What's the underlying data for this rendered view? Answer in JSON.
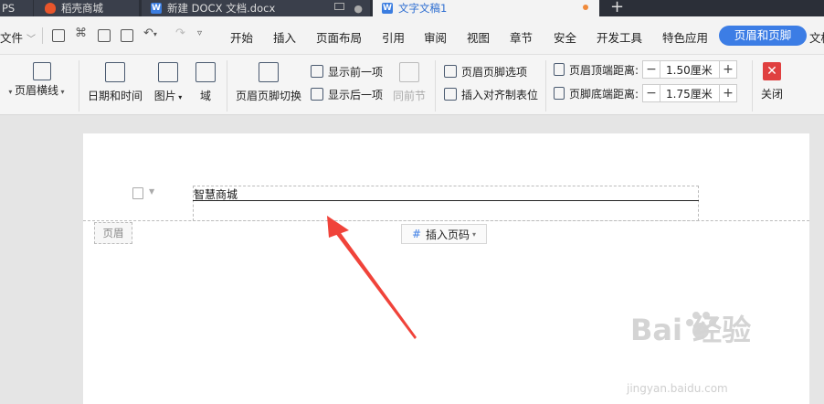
{
  "tabs": [
    {
      "label": "PS"
    },
    {
      "label": "稻壳商城"
    },
    {
      "label": "新建 DOCX 文档.docx"
    },
    {
      "label": "文字文稿1"
    }
  ],
  "menu": {
    "file": "文件",
    "items": [
      "开始",
      "插入",
      "页面布局",
      "引用",
      "审阅",
      "视图",
      "章节",
      "安全",
      "开发工具",
      "特色应用"
    ],
    "active": "页眉和页脚",
    "overflow": "文档"
  },
  "ribbon": {
    "header_line": "页眉横线",
    "datetime": "日期和时间",
    "picture": "图片",
    "field": "域",
    "switch": "页眉页脚切换",
    "show_prev": "显示前一项",
    "show_next": "显示后一项",
    "same_prev": "同前节",
    "options": "页眉页脚选项",
    "insert_align_tab": "插入对齐制表位",
    "top_margin_label": "页眉顶端距离:",
    "top_margin_value": "1.50厘米",
    "bottom_margin_label": "页脚底端距离:",
    "bottom_margin_value": "1.75厘米",
    "close": "关闭"
  },
  "document": {
    "header_text": "智慧商城",
    "header_label": "页眉",
    "insert_page_number": "插入页码"
  },
  "watermark": {
    "main": "Bai 经验",
    "sub": "jingyan.baidu.com"
  },
  "colors": {
    "accent": "#3c7de5",
    "arrow": "#f0433a",
    "close": "#e04040"
  }
}
